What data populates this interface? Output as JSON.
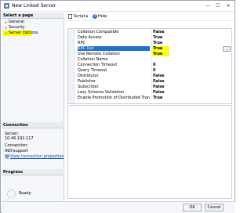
{
  "window": {
    "title": "New Linked Server",
    "controls": {
      "minimize": "—",
      "maximize": "☐",
      "close": "✕"
    }
  },
  "left_pane": {
    "select_page_header": "Select a page",
    "pages": [
      {
        "label": "General",
        "selected": false
      },
      {
        "label": "Security",
        "selected": false
      },
      {
        "label": "Server Options",
        "selected": true
      }
    ],
    "connection_header": "Connection",
    "connection": {
      "server_label": "Server:",
      "server_value": "10.46.192.117",
      "connection_label": "Connection:",
      "connection_value": "IND\\support",
      "view_link": "View connection properties"
    },
    "progress_header": "Progress",
    "progress_status": "Ready"
  },
  "toolbar": {
    "script_label": "Script",
    "help_label": "Help",
    "help_glyph": "?"
  },
  "properties": [
    {
      "name": "Collation Compatible",
      "value": "False"
    },
    {
      "name": "Data Access",
      "value": "True"
    },
    {
      "name": "RPC",
      "value": "True"
    },
    {
      "name": "RPC Out",
      "value": "True"
    },
    {
      "name": "Use Remote Collation",
      "value": "True"
    },
    {
      "name": "Collation Name",
      "value": ""
    },
    {
      "name": "Connection Timeout",
      "value": "0"
    },
    {
      "name": "Query Timeout",
      "value": "0"
    },
    {
      "name": "Distributor",
      "value": "False"
    },
    {
      "name": "Publisher",
      "value": "False"
    },
    {
      "name": "Subscriber",
      "value": "False"
    },
    {
      "name": "Lazy Schema Validation",
      "value": "False"
    },
    {
      "name": "Enable Promotion of Distributed Transaction",
      "value": "True"
    }
  ],
  "property_dropdown_glyph": "⌄",
  "buttons": {
    "ok": "OK",
    "cancel": "Cancel"
  },
  "colors": {
    "highlight": "#ffff00",
    "selection": "#1e73c9",
    "link": "#1a4fa8"
  }
}
